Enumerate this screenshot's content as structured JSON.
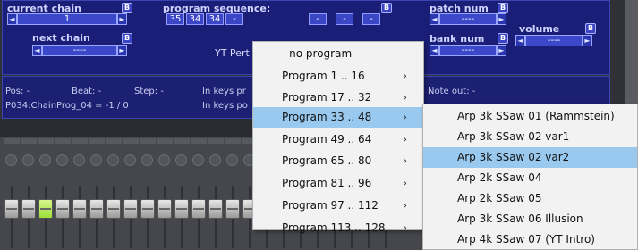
{
  "current_chain": {
    "title": "current chain",
    "badge": "B",
    "value": "1"
  },
  "next_chain": {
    "title": "next chain",
    "badge": "B",
    "value": "----"
  },
  "program_sequence": {
    "title": "program sequence:",
    "badge": "B",
    "cells": [
      "35",
      "34",
      "34",
      "-",
      "-",
      "-",
      "-",
      "-"
    ],
    "bottom_label": "YT Pert"
  },
  "patch_num": {
    "title": "patch num",
    "badge": "B",
    "value": "----"
  },
  "bank_num": {
    "title": "bank num",
    "badge": "B",
    "value": "----"
  },
  "volume": {
    "title": "volume",
    "badge": "B",
    "value": "----"
  },
  "status": {
    "pos": "Pos: -",
    "beat": "Beat: -",
    "step": "Step: -",
    "in_keys_1": "In keys pr",
    "note_out": "Note out:   -",
    "chain_prog": "P034:ChainProg_04 = -1 / 0",
    "in_keys_2": "In keys po"
  },
  "menu": {
    "items": [
      {
        "label": "- no program -",
        "has_sub": false
      },
      {
        "label": "Program 1 .. 16",
        "has_sub": true
      },
      {
        "label": "Program 17 .. 32",
        "has_sub": true
      },
      {
        "label": "Program 33 .. 48",
        "has_sub": true,
        "selected": true
      },
      {
        "label": "Program 49 .. 64",
        "has_sub": true
      },
      {
        "label": "Program 65 .. 80",
        "has_sub": true
      },
      {
        "label": "Program 81 .. 96",
        "has_sub": true
      },
      {
        "label": "Program 97 .. 112",
        "has_sub": true
      },
      {
        "label": "Program 113 .. 128",
        "has_sub": true
      }
    ],
    "chevron": "›"
  },
  "submenu": {
    "items": [
      {
        "label": "Arp 3k SSaw 01 (Rammstein)"
      },
      {
        "label": "Arp 3k SSaw 02 var1"
      },
      {
        "label": "Arp 3k SSaw 02 var2",
        "selected": true
      },
      {
        "label": "Arp 2k SSaw 04"
      },
      {
        "label": "Arp 2k SSaw 05"
      },
      {
        "label": "Arp 3k SSaw 06 Illusion"
      },
      {
        "label": "Arp 4k SSaw 07 (YT Intro)"
      }
    ]
  },
  "icons": {
    "left_arrow": "◄",
    "right_arrow": "►"
  },
  "colors": {
    "panel": "#1a1e77",
    "menu_highlight": "#99c9ef",
    "fader_active": "#9be03a"
  }
}
